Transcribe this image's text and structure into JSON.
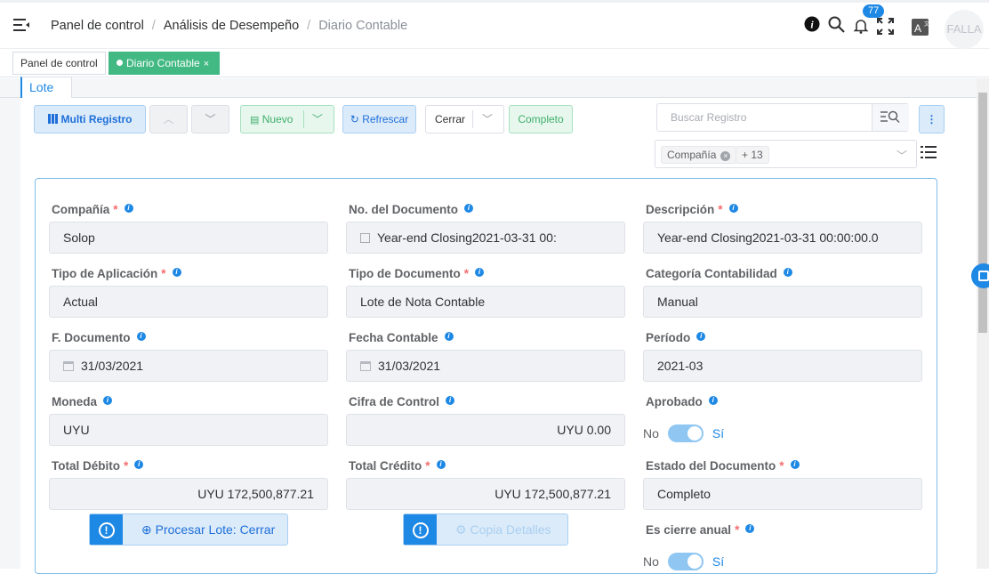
{
  "breadcrumb": {
    "items": [
      "Panel de control",
      "Análisis de Desempeño",
      "Diario Contable"
    ]
  },
  "header": {
    "notifications_count": "77",
    "avatar_text": "FALLA"
  },
  "tabs": [
    {
      "label": "Panel de control"
    },
    {
      "label": "Diario Contable"
    }
  ],
  "subtab": {
    "label": "Lote"
  },
  "toolbar": {
    "multi_label": "Multi Registro",
    "nuevo_label": "Nuevo",
    "refresh_label": "Refrescar",
    "action_value": "Cerrar",
    "status_label": "Completo",
    "search_placeholder": "Buscar Registro",
    "filter_tag": "Compañía",
    "filter_more": "+ 13"
  },
  "form": {
    "company": {
      "label": "Compañía",
      "value": "Solop"
    },
    "doc_no": {
      "label": "No. del Documento",
      "value": "Year-end Closing2021-03-31 00:"
    },
    "description": {
      "label": "Descripción",
      "value": "Year-end Closing2021-03-31 00:00:00.0"
    },
    "app_type": {
      "label": "Tipo de Aplicación",
      "value": "Actual"
    },
    "doc_type": {
      "label": "Tipo de Documento",
      "value": "Lote de Nota Contable"
    },
    "category": {
      "label": "Categoría Contabilidad",
      "value": "Manual"
    },
    "doc_date": {
      "label": "F. Documento",
      "value": "31/03/2021"
    },
    "acct_date": {
      "label": "Fecha Contable",
      "value": "31/03/2021"
    },
    "period": {
      "label": "Período",
      "value": "2021-03"
    },
    "currency": {
      "label": "Moneda",
      "value": "UYU"
    },
    "control": {
      "label": "Cifra de Control",
      "value": "UYU 0.00"
    },
    "approved": {
      "label": "Aprobado",
      "off": "No",
      "on": "Sí"
    },
    "total_debit": {
      "label": "Total Débito",
      "value": "UYU 172,500,877.21"
    },
    "total_credit": {
      "label": "Total Crédito",
      "value": "UYU 172,500,877.21"
    },
    "doc_status": {
      "label": "Estado del Documento",
      "value": "Completo"
    },
    "year_close": {
      "label": "Es cierre anual",
      "off": "No",
      "on": "Sí"
    },
    "process_button": "Procesar Lote: Cerrar",
    "copy_button": "Copia Detalles"
  }
}
